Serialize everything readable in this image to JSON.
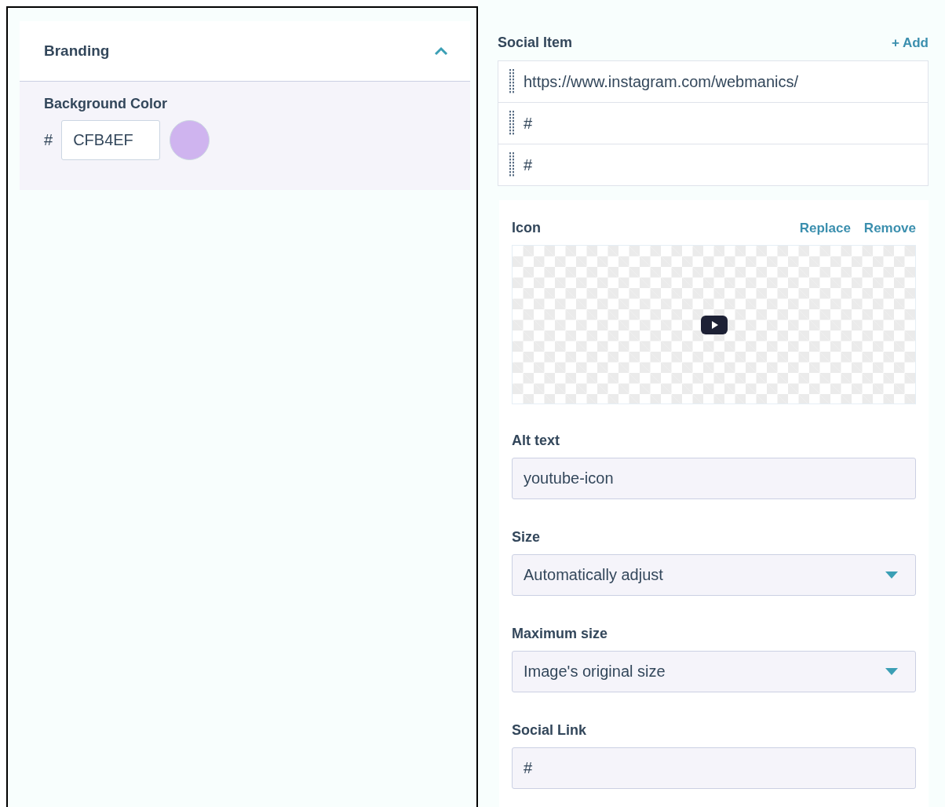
{
  "branding": {
    "title": "Branding",
    "expanded": true,
    "background_color": {
      "label": "Background Color",
      "prefix": "#",
      "value": "CFB4EF"
    }
  },
  "social_item": {
    "title": "Social Item",
    "add_link": "+ Add",
    "items": [
      {
        "text": "https://www.instagram.com/webmanics/"
      },
      {
        "text": "#"
      },
      {
        "text": "#"
      }
    ]
  },
  "icon": {
    "label": "Icon",
    "actions": [
      "Replace",
      "Remove"
    ]
  },
  "fields": [
    {
      "kind": "text",
      "label": "Alt text",
      "value": "youtube-icon"
    },
    {
      "kind": "select",
      "label": "Size",
      "value": "Automatically adjust"
    },
    {
      "kind": "select",
      "label": "Maximum size",
      "value": "Image's original size"
    },
    {
      "kind": "text",
      "label": "Social Link",
      "value": "#"
    }
  ]
}
